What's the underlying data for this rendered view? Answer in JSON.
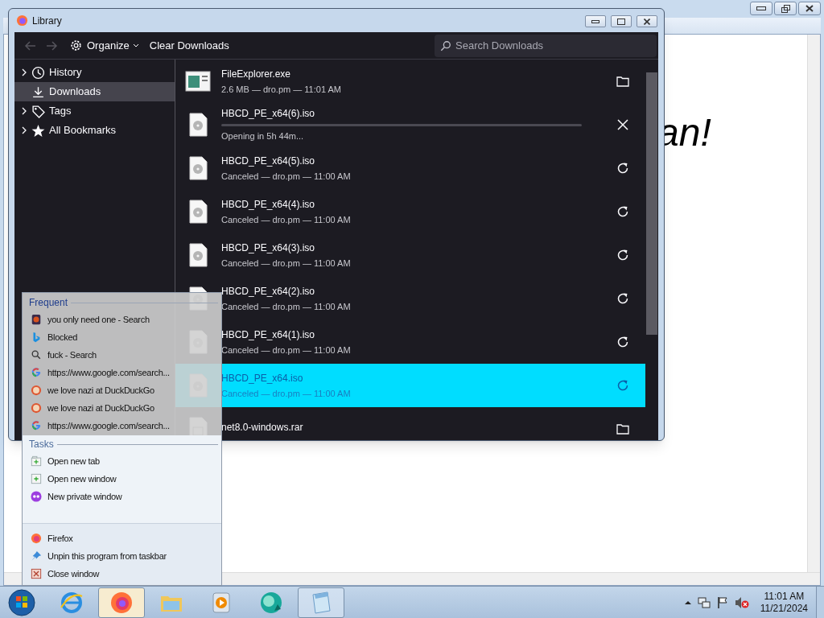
{
  "notepad": {
    "text": "an!"
  },
  "library": {
    "title": "Library",
    "nav": {
      "disabled": true
    },
    "organize": "Organize",
    "clear": "Clear Downloads",
    "search_placeholder": "Search Downloads",
    "sidebar": [
      {
        "label": "History",
        "expandable": true,
        "selected": false
      },
      {
        "label": "Downloads",
        "expandable": false,
        "selected": true
      },
      {
        "label": "Tags",
        "expandable": true,
        "selected": false
      },
      {
        "label": "All Bookmarks",
        "expandable": true,
        "selected": false
      }
    ],
    "downloads": [
      {
        "name": "FileExplorer.exe",
        "status": "2.6 MB — dro.pm — 11:01 AM",
        "kind": "program",
        "in_progress": false,
        "canceled": false,
        "selected": false
      },
      {
        "name": "HBCD_PE_x64(6).iso",
        "status": "Opening in 5h 44m...",
        "kind": "disc",
        "in_progress": true,
        "level": 0,
        "selected": false
      },
      {
        "name": "HBCD_PE_x64(5).iso",
        "status": "Canceled — dro.pm — 11:00 AM",
        "kind": "disc",
        "in_progress": false,
        "canceled": true,
        "selected": false
      },
      {
        "name": "HBCD_PE_x64(4).iso",
        "status": "Canceled — dro.pm — 11:00 AM",
        "kind": "disc",
        "in_progress": false,
        "canceled": true,
        "selected": false
      },
      {
        "name": "HBCD_PE_x64(3).iso",
        "status": "Canceled — dro.pm — 11:00 AM",
        "kind": "disc",
        "in_progress": false,
        "canceled": true,
        "selected": false
      },
      {
        "name": "HBCD_PE_x64(2).iso",
        "status": "Canceled — dro.pm — 11:00 AM",
        "kind": "disc",
        "in_progress": false,
        "canceled": true,
        "selected": false
      },
      {
        "name": "HBCD_PE_x64(1).iso",
        "status": "Canceled — dro.pm — 11:00 AM",
        "kind": "disc",
        "in_progress": false,
        "canceled": true,
        "selected": false
      },
      {
        "name": "HBCD_PE_x64.iso",
        "status": "Canceled — dro.pm — 11:00 AM",
        "kind": "disc",
        "in_progress": false,
        "canceled": true,
        "selected": true
      },
      {
        "name": "net8.0-windows.rar",
        "kind": "archive",
        "in_progress": false,
        "canceled": false,
        "selected": false
      }
    ]
  },
  "jump_list": {
    "frequent_header": "Frequent",
    "frequent": [
      {
        "label": "you only need one - Search",
        "kind": "thumb"
      },
      {
        "label": "Blocked",
        "kind": "bing"
      },
      {
        "label": "fuck - Search",
        "kind": "search"
      },
      {
        "label": "https://www.google.com/search...",
        "kind": "google"
      },
      {
        "label": "we love nazi at DuckDuckGo",
        "kind": "duck"
      },
      {
        "label": "we love nazi at DuckDuckGo",
        "kind": "duck"
      },
      {
        "label": "https://www.google.com/search...",
        "kind": "google"
      }
    ],
    "tasks_header": "Tasks",
    "tasks": [
      {
        "label": "Open new tab",
        "kind": "tab"
      },
      {
        "label": "Open new window",
        "kind": "window"
      },
      {
        "label": "New private window",
        "kind": "private"
      }
    ],
    "app": [
      {
        "label": "Firefox",
        "kind": "firefox"
      },
      {
        "label": "Unpin this program from taskbar",
        "kind": "pin"
      },
      {
        "label": "Close window",
        "kind": "close"
      }
    ]
  },
  "taskbar": {
    "apps": [
      {
        "kind": "ie",
        "selected": false,
        "running": false
      },
      {
        "kind": "firefox",
        "selected": true,
        "running": true
      },
      {
        "kind": "folder",
        "selected": false,
        "running": false
      },
      {
        "kind": "media",
        "selected": false,
        "running": false
      },
      {
        "kind": "sphere",
        "selected": false,
        "running": false
      },
      {
        "kind": "notepad",
        "selected": false,
        "running": true
      }
    ],
    "time": "11:01 AM",
    "date": "11/21/2024"
  }
}
